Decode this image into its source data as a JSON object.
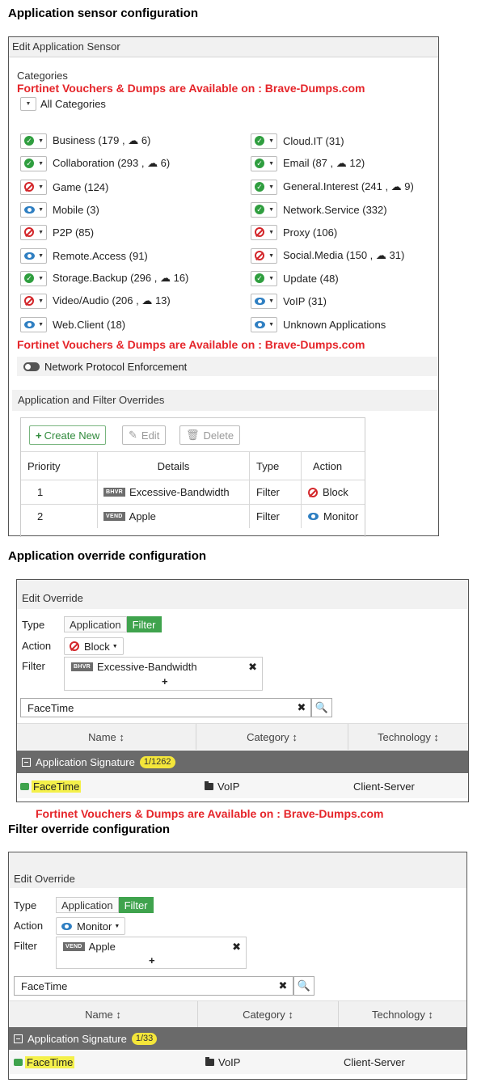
{
  "watermark": "Fortinet Vouchers & Dumps are Available on : Brave-Dumps.com",
  "section1_title": "Application sensor configuration",
  "section2_title": "Application override configuration",
  "section3_title": "Filter override configuration",
  "sensor": {
    "header": "Edit Application Sensor",
    "categories_label": "Categories",
    "all_categories": "All Categories",
    "categories_left": [
      {
        "label": "Business (179 , ☁ 6)",
        "action": "allow"
      },
      {
        "label": "Collaboration (293 , ☁ 6)",
        "action": "allow"
      },
      {
        "label": "Game (124)",
        "action": "block"
      },
      {
        "label": "Mobile (3)",
        "action": "monitor"
      },
      {
        "label": "P2P (85)",
        "action": "block"
      },
      {
        "label": "Remote.Access (91)",
        "action": "monitor"
      },
      {
        "label": "Storage.Backup (296 , ☁ 16)",
        "action": "allow"
      },
      {
        "label": "Video/Audio (206 , ☁ 13)",
        "action": "block"
      },
      {
        "label": "Web.Client (18)",
        "action": "monitor"
      }
    ],
    "categories_right": [
      {
        "label": "Cloud.IT (31)",
        "action": "allow"
      },
      {
        "label": "Email (87 , ☁ 12)",
        "action": "allow"
      },
      {
        "label": "General.Interest (241 , ☁ 9)",
        "action": "allow"
      },
      {
        "label": "Network.Service (332)",
        "action": "allow"
      },
      {
        "label": "Proxy (106)",
        "action": "block"
      },
      {
        "label": "Social.Media (150 , ☁ 31)",
        "action": "block"
      },
      {
        "label": "Update (48)",
        "action": "allow"
      },
      {
        "label": "VoIP (31)",
        "action": "monitor"
      },
      {
        "label": "Unknown Applications",
        "action": "monitor"
      }
    ],
    "network_protocol_enforcement": "Network Protocol Enforcement",
    "overrides_header": "Application and Filter Overrides",
    "buttons": {
      "create": "Create New",
      "edit": "Edit",
      "delete": "Delete"
    },
    "table_headers": {
      "priority": "Priority",
      "details": "Details",
      "type": "Type",
      "action": "Action"
    },
    "rows": [
      {
        "priority": "1",
        "badge": "BHVR",
        "details": "Excessive-Bandwidth",
        "type": "Filter",
        "action": "Block"
      },
      {
        "priority": "2",
        "badge": "VEND",
        "details": "Apple",
        "type": "Filter",
        "action": "Monitor"
      }
    ]
  },
  "override1": {
    "header": "Edit Override",
    "type_label": "Type",
    "type_options": [
      "Application",
      "Filter"
    ],
    "action_label": "Action",
    "action_value": "Block",
    "filter_label": "Filter",
    "filter_badge": "BHVR",
    "filter_value": "Excessive-Bandwidth",
    "search_value": "FaceTime",
    "col_name": "Name ↕",
    "col_category": "Category ↕",
    "col_technology": "Technology ↕",
    "sig_label": "Application Signature",
    "sig_count": "1/1262",
    "result_name": "FaceTime",
    "result_category": "VoIP",
    "result_technology": "Client-Server"
  },
  "override2": {
    "header": "Edit Override",
    "type_label": "Type",
    "type_options": [
      "Application",
      "Filter"
    ],
    "action_label": "Action",
    "action_value": "Monitor",
    "filter_label": "Filter",
    "filter_badge": "VEND",
    "filter_value": "Apple",
    "search_value": "FaceTime",
    "col_name": "Name ↕",
    "col_category": "Category ↕",
    "col_technology": "Technology ↕",
    "sig_label": "Application Signature",
    "sig_count": "1/33",
    "result_name": "FaceTime",
    "result_category": "VoIP",
    "result_technology": "Client-Server"
  }
}
